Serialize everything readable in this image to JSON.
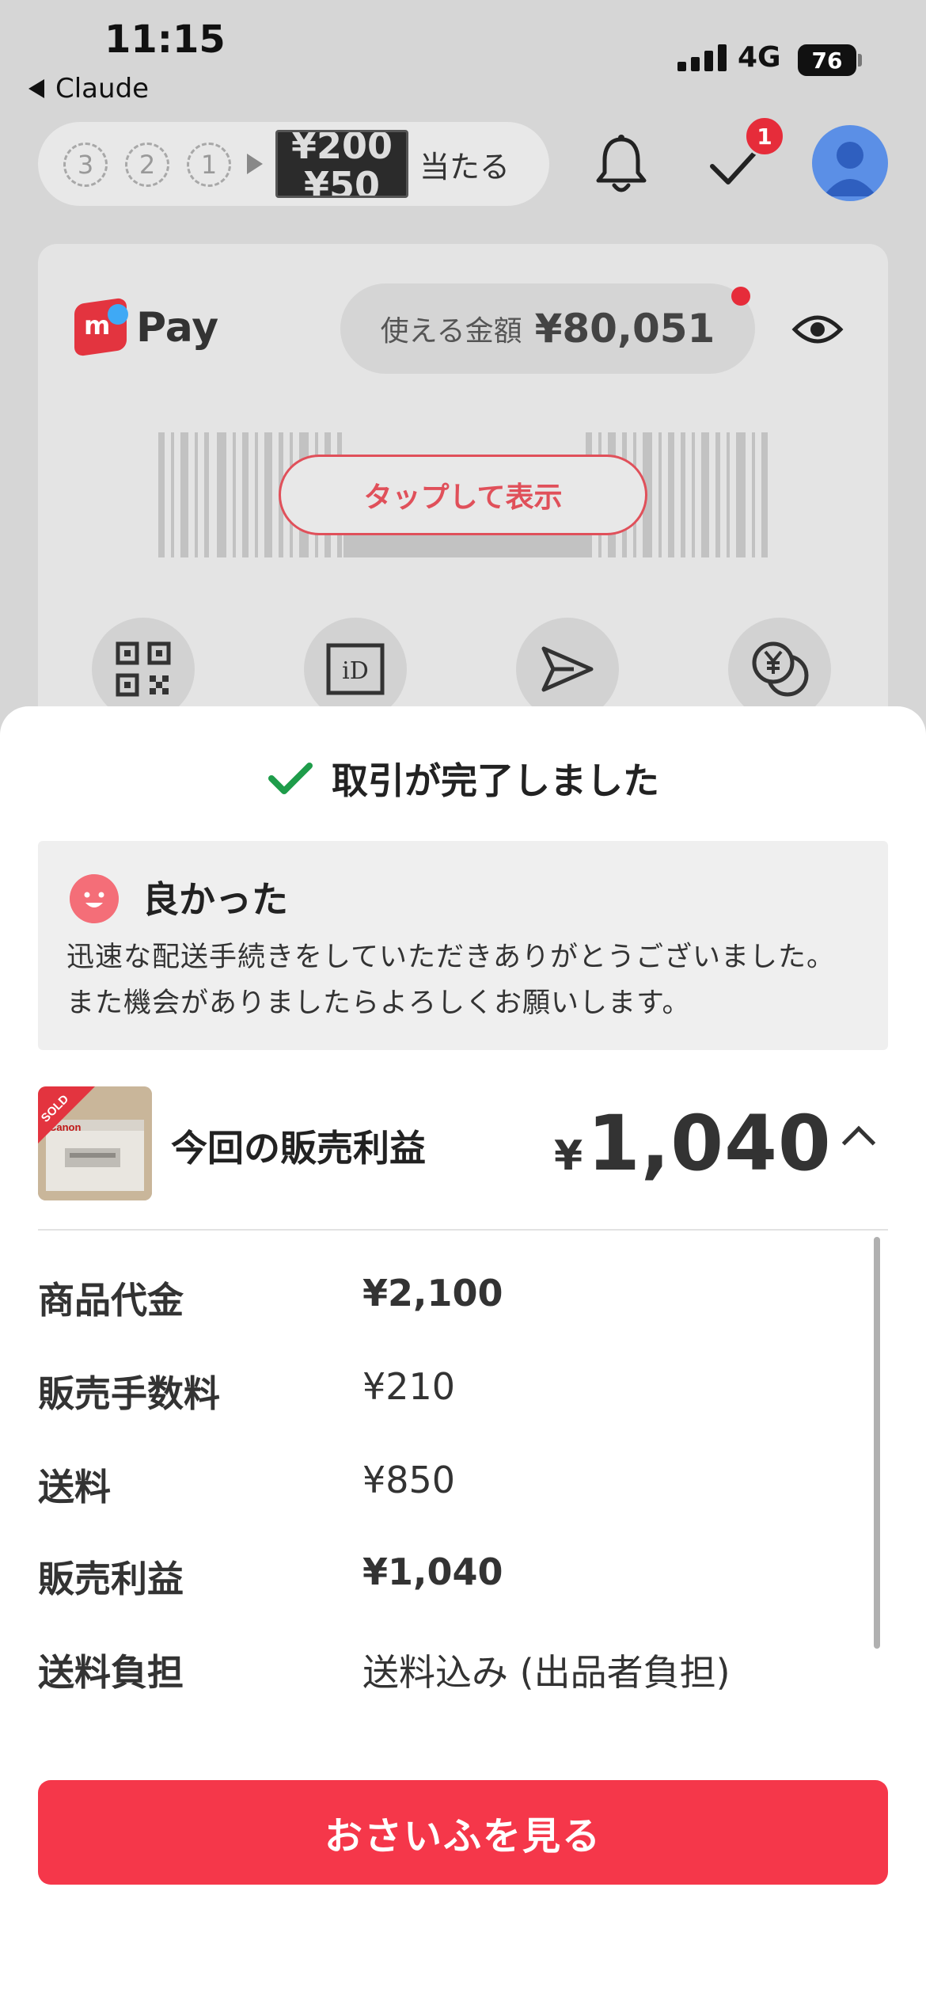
{
  "status_bar": {
    "time": "11:15",
    "back_app": "Claude",
    "network": "4G",
    "battery": "76"
  },
  "header": {
    "promo_steps": [
      "3",
      "2",
      "1"
    ],
    "promo_ticket_top": "¥200",
    "promo_ticket_bottom": "¥50",
    "promo_label": "当たる",
    "todo_badge": "1"
  },
  "pay_card": {
    "logo_mark": "m",
    "logo_text": "Pay",
    "balance_label": "使える金額",
    "balance_amount": "¥80,051",
    "tap_label": "タップして表示",
    "quick_actions": [
      "qr-code-icon",
      "id-icon",
      "send-icon",
      "coins-icon"
    ]
  },
  "sheet": {
    "title": "取引が完了しました",
    "review": {
      "rating": "良かった",
      "comment": "迅速な配送手続きをしていただきありがとうございました。また機会がありましたらよろしくお願いします。"
    },
    "thumbnail_tag": "SOLD",
    "thumbnail_brand": "Canon",
    "profit_label": "今回の販売利益",
    "profit_currency": "¥",
    "profit_amount": "1,040",
    "rows": [
      {
        "label": "商品代金",
        "value": "¥2,100"
      },
      {
        "label": "販売手数料",
        "value": "¥210"
      },
      {
        "label": "送料",
        "value": "¥850"
      },
      {
        "label": "販売利益",
        "value": "¥1,040"
      },
      {
        "label": "送料負担",
        "value": "送料込み (出品者負担)"
      }
    ],
    "cta": "おさいふを見る"
  },
  "colors": {
    "accent": "#f5374a",
    "check": "#1e9c4a",
    "avatar": "#5b8fe6",
    "badge": "#e62c3a"
  }
}
